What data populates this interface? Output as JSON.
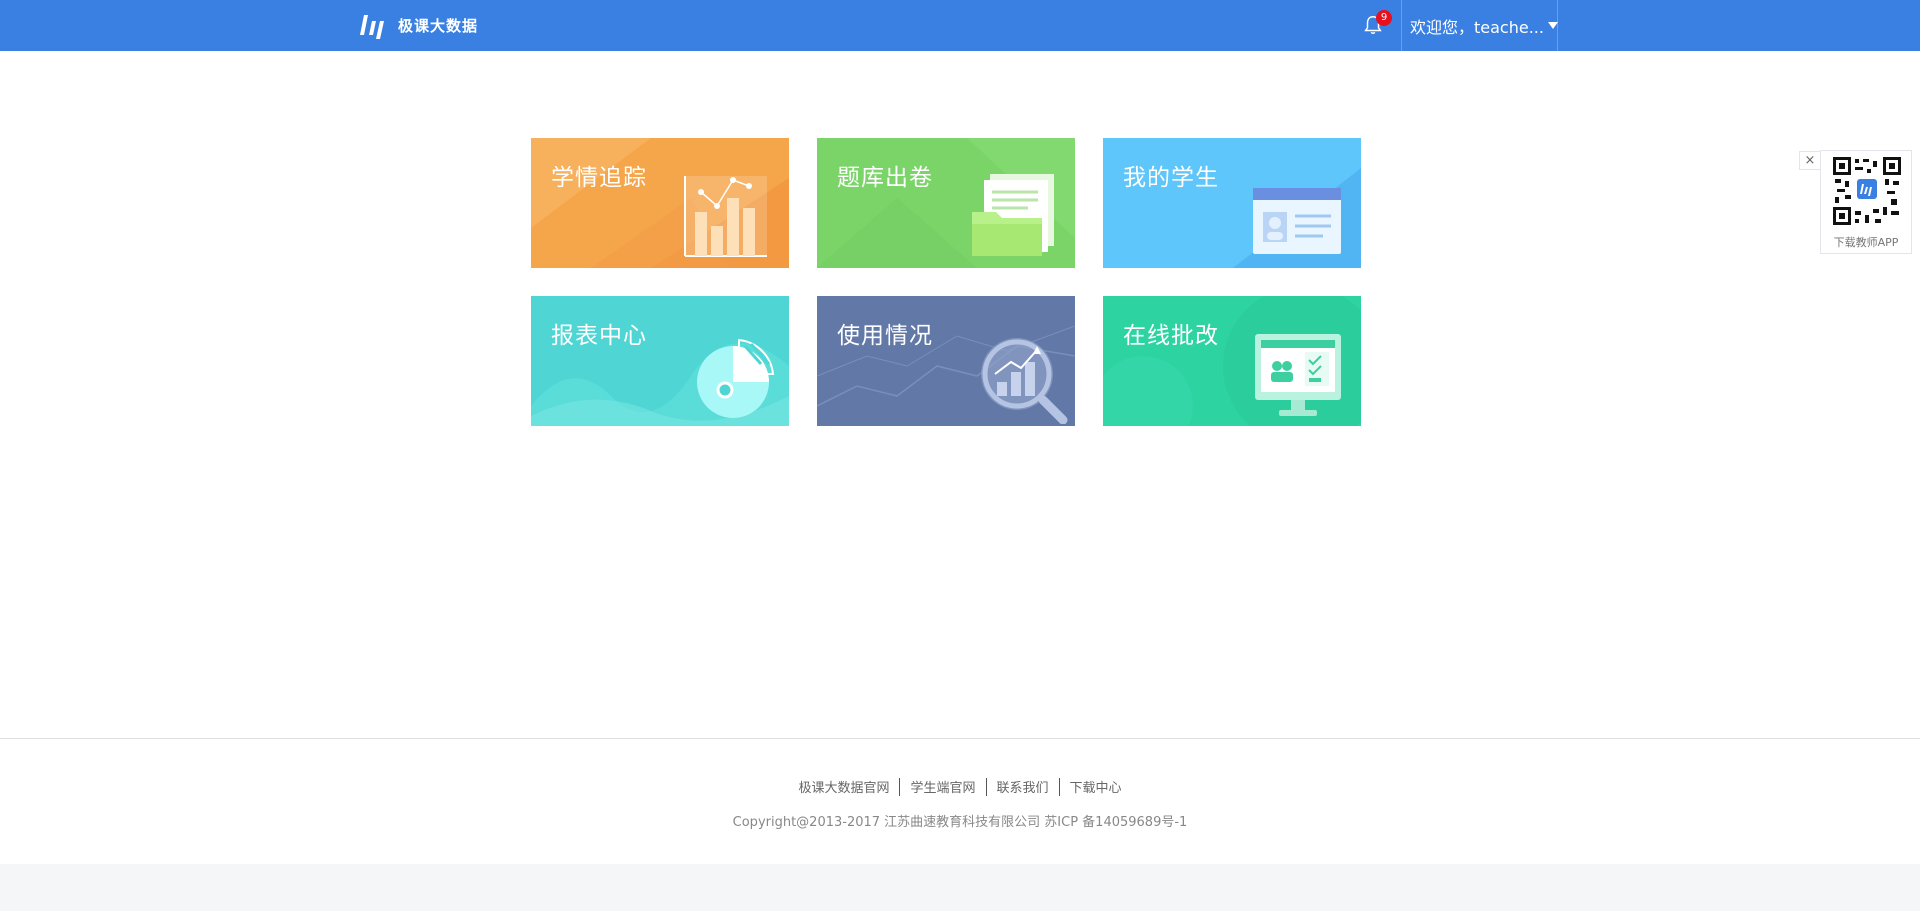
{
  "header": {
    "brand": "极课大数据",
    "notification_count": "9",
    "user_greeting": "欢迎您，teache..."
  },
  "tiles": [
    {
      "title": "学情追踪",
      "color": "#f5a54a",
      "icon": "bar-chart-icon"
    },
    {
      "title": "题库出卷",
      "color": "#7ad468",
      "icon": "folder-documents-icon"
    },
    {
      "title": "我的学生",
      "color": "#4fb8f5",
      "icon": "student-card-icon"
    },
    {
      "title": "报表中心",
      "color": "#4fd6d4",
      "icon": "pie-chart-icon"
    },
    {
      "title": "使用情况",
      "color": "#6278a6",
      "icon": "magnifier-chart-icon"
    },
    {
      "title": "在线批改",
      "color": "#2ed3a2",
      "icon": "monitor-grading-icon"
    }
  ],
  "qr_widget": {
    "close": "×",
    "caption": "下载教师APP"
  },
  "footer": {
    "links": [
      "极课大数据官网",
      "学生端官网",
      "联系我们",
      "下载中心"
    ],
    "copyright": "Copyright@2013-2017 江苏曲速教育科技有限公司 苏ICP 备14059689号-1"
  }
}
